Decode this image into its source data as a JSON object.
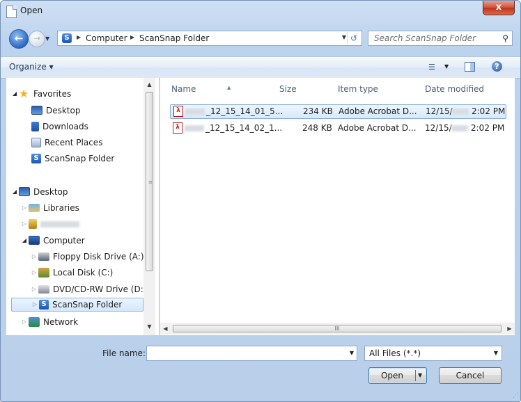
{
  "window": {
    "title": "Open",
    "close_label": "x"
  },
  "address": {
    "crumbs": [
      "Computer",
      "ScanSnap Folder"
    ],
    "search_placeholder": "Search ScanSnap Folder"
  },
  "toolbar": {
    "organize_label": "Organize ▾"
  },
  "nav_pane": {
    "favorites": {
      "label": "Favorites",
      "items": [
        {
          "label": "Desktop",
          "icon": "desktop-icon"
        },
        {
          "label": "Downloads",
          "icon": "downloads-icon"
        },
        {
          "label": "Recent Places",
          "icon": "recent-places-icon"
        },
        {
          "label": "ScanSnap Folder",
          "icon": "scansnap-icon"
        }
      ]
    },
    "desktop": {
      "label": "Desktop",
      "libraries_label": "Libraries",
      "computer_label": "Computer",
      "drives": [
        {
          "label": "Floppy Disk Drive (A:)",
          "icon": "floppy-drive-icon"
        },
        {
          "label": "Local Disk (C:)",
          "icon": "local-disk-icon"
        },
        {
          "label": "DVD/CD-RW Drive (D:)",
          "icon": "dvd-drive-icon"
        },
        {
          "label": "ScanSnap Folder",
          "icon": "scansnap-icon",
          "selected": true
        }
      ],
      "network_label": "Network"
    }
  },
  "file_list": {
    "columns": [
      "Name",
      "Size",
      "Item type",
      "Date modified"
    ],
    "rows": [
      {
        "name": "_12_15_14_01_5...",
        "size": "234 KB",
        "type": "Adobe Acrobat D...",
        "date_prefix": "12/15/",
        "time": "2:02 PM",
        "selected": true
      },
      {
        "name": "_12_15_14_02_1...",
        "size": "248 KB",
        "type": "Adobe Acrobat D...",
        "date_prefix": "12/15/",
        "time": "2:02 PM",
        "selected": false
      }
    ]
  },
  "hscroll_grip": "III",
  "bottom": {
    "file_name_label": "File name:",
    "file_name_value": "",
    "file_type_selected": "All Files (*.*)",
    "open_label": "Open",
    "cancel_label": "Cancel"
  }
}
